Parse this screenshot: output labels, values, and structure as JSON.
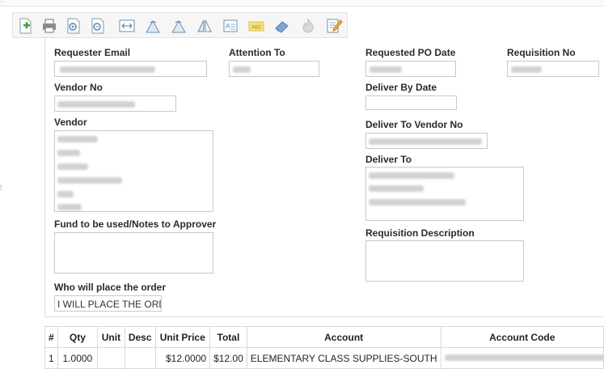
{
  "toolbar": {
    "icons": [
      "add-page-icon",
      "print-icon",
      "zoom-in-icon",
      "zoom-out-icon",
      "fit-page-icon",
      "rotate-left-icon",
      "rotate-right-icon",
      "flip-icon",
      "text-box-icon",
      "highlight-icon",
      "eraser-icon",
      "flame-icon",
      "edit-icon"
    ]
  },
  "form": {
    "requester_email": {
      "label": "Requester Email"
    },
    "attention_to": {
      "label": "Attention To"
    },
    "requested_po_date": {
      "label": "Requested PO Date"
    },
    "requisition_no": {
      "label": "Requisition No"
    },
    "vendor_no": {
      "label": "Vendor No"
    },
    "deliver_by_date": {
      "label": "Deliver By Date"
    },
    "vendor": {
      "label": "Vendor"
    },
    "deliver_to_vendor_no": {
      "label": "Deliver To Vendor No"
    },
    "deliver_to": {
      "label": "Deliver To"
    },
    "fund_notes": {
      "label": "Fund to be used/Notes to Approver"
    },
    "requisition_description": {
      "label": "Requisition Description"
    },
    "who_will_place": {
      "label": "Who will place the order",
      "value": "I WILL PLACE THE ORDER"
    }
  },
  "table": {
    "headers": [
      "#",
      "Qty",
      "Unit",
      "Desc",
      "Unit Price",
      "Total",
      "Account",
      "Account Code"
    ],
    "rows": [
      {
        "num": "1",
        "qty": "1.0000",
        "unit": "",
        "desc": "",
        "unit_price": "$12.0000",
        "total": "$12.00",
        "account": "ELEMENTARY CLASS SUPPLIES-SOUTH"
      }
    ]
  }
}
